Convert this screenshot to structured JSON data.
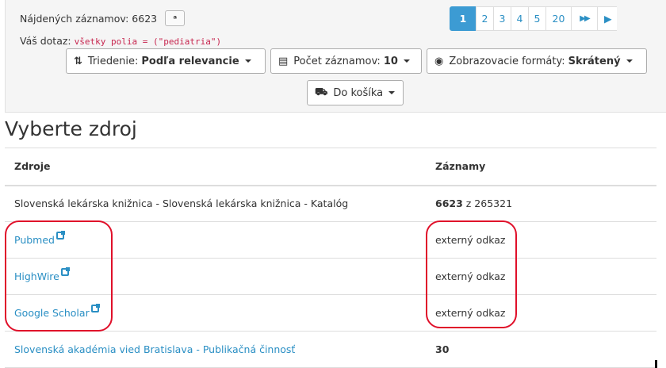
{
  "results": {
    "found_label": "Nájdených záznamov:",
    "found_count": "6623",
    "rss_icon": "rss-icon",
    "query_label": "Váš dotaz:",
    "query_value": "všetky polia = (\"pediatria\")"
  },
  "pagination": {
    "pages": [
      "1",
      "2",
      "3",
      "4",
      "5",
      "20"
    ],
    "active": "1",
    "next_icon": "fast-forward-icon",
    "last_icon": "last-page-icon"
  },
  "toolbar": {
    "sort_label": "Triedenie:",
    "sort_value": "Podľa relevancie",
    "count_label": "Počet záznamov:",
    "count_value": "10",
    "format_label": "Zobrazovacie formáty:",
    "format_value": "Skrátený",
    "cart_label": "Do košíka"
  },
  "section_title": "Vyberte zdroj",
  "table": {
    "headers": [
      "Zdroje",
      "Záznamy"
    ],
    "rows": [
      {
        "source": "Slovenská lekárska knižnica - Slovenská lekárska knižnica - Katalóg",
        "link": false,
        "external": false,
        "count_bold": "6623",
        "count_rest": " z 265321"
      },
      {
        "source": "Pubmed",
        "link": true,
        "external": true,
        "count_bold": "",
        "count_rest": "externý odkaz"
      },
      {
        "source": "HighWire",
        "link": true,
        "external": true,
        "count_bold": "",
        "count_rest": "externý odkaz"
      },
      {
        "source": "Google Scholar",
        "link": true,
        "external": true,
        "count_bold": "",
        "count_rest": "externý odkaz"
      },
      {
        "source": "Slovenská akadémia vied Bratislava - Publikačná činnosť",
        "link": true,
        "external": false,
        "count_bold": "30",
        "count_rest": ""
      }
    ]
  },
  "colors": {
    "link": "#2a8fc4",
    "active_page": "#3c9bd3",
    "annotation": "#e0102a",
    "query_code": "#c7254e"
  }
}
